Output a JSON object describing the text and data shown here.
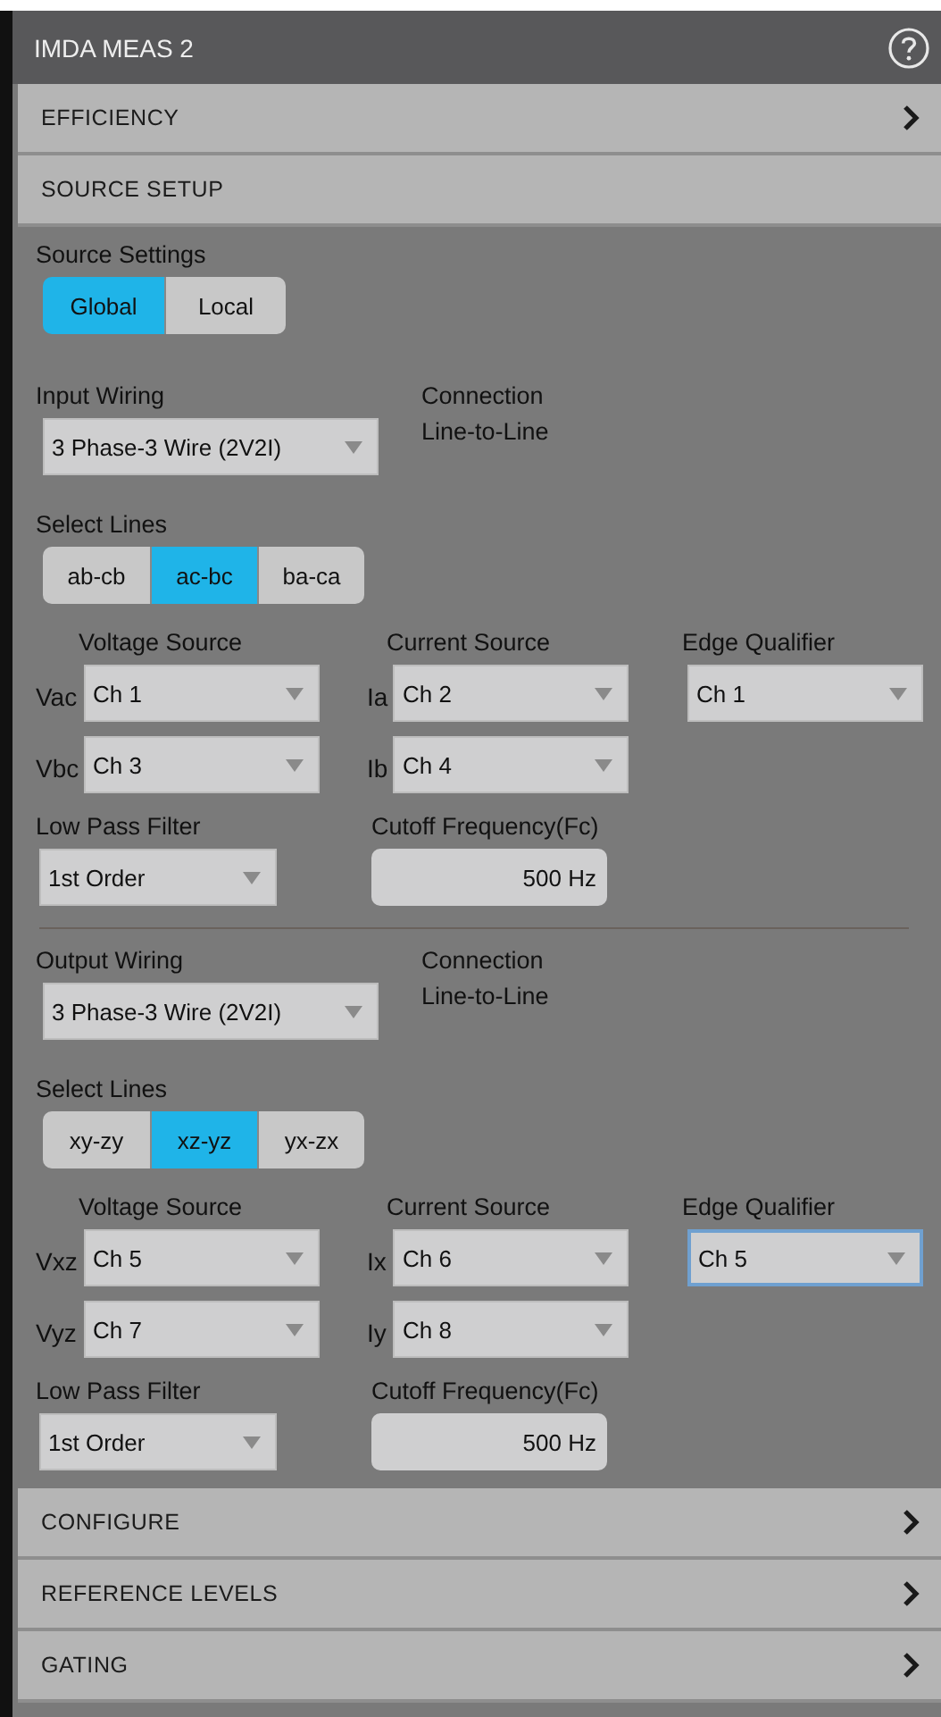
{
  "panel": {
    "title": "IMDA MEAS 2"
  },
  "sections_top": [
    {
      "label": "EFFICIENCY",
      "expanded": false
    }
  ],
  "source_setup": {
    "label": "SOURCE SETUP",
    "expanded": true,
    "source_settings": {
      "label": "Source Settings",
      "options": [
        {
          "label": "Global",
          "selected": true
        },
        {
          "label": "Local",
          "selected": false
        }
      ]
    },
    "groups": [
      {
        "wiring_label": "Input Wiring",
        "wiring_value": "3 Phase-3 Wire (2V2I)",
        "connection_label": "Connection",
        "connection_value": "Line-to-Line",
        "select_lines_label": "Select Lines",
        "lines": [
          {
            "label": "ab-cb",
            "selected": false
          },
          {
            "label": "ac-bc",
            "selected": true
          },
          {
            "label": "ba-ca",
            "selected": false
          }
        ],
        "voltage_heading": "Voltage Source",
        "current_heading": "Current Source",
        "edge_heading": "Edge Qualifier",
        "voltage_rows": [
          {
            "prefix": "Vac",
            "value": "Ch 1"
          },
          {
            "prefix": "Vbc",
            "value": "Ch 3"
          }
        ],
        "current_rows": [
          {
            "prefix": "Ia",
            "value": "Ch 2"
          },
          {
            "prefix": "Ib",
            "value": "Ch 4"
          }
        ],
        "edge_value": "Ch 1",
        "edge_focused": false,
        "filter_label": "Low Pass Filter",
        "filter_value": "1st Order",
        "cutoff_label": "Cutoff Frequency(Fc)",
        "cutoff_value": "500 Hz"
      },
      {
        "wiring_label": "Output Wiring",
        "wiring_value": "3 Phase-3 Wire (2V2I)",
        "connection_label": "Connection",
        "connection_value": "Line-to-Line",
        "select_lines_label": "Select Lines",
        "lines": [
          {
            "label": "xy-zy",
            "selected": false
          },
          {
            "label": "xz-yz",
            "selected": true
          },
          {
            "label": "yx-zx",
            "selected": false
          }
        ],
        "voltage_heading": "Voltage Source",
        "current_heading": "Current Source",
        "edge_heading": "Edge Qualifier",
        "voltage_rows": [
          {
            "prefix": "Vxz",
            "value": "Ch 5"
          },
          {
            "prefix": "Vyz",
            "value": "Ch 7"
          }
        ],
        "current_rows": [
          {
            "prefix": "Ix",
            "value": "Ch 6"
          },
          {
            "prefix": "Iy",
            "value": "Ch 8"
          }
        ],
        "edge_value": "Ch 5",
        "edge_focused": true,
        "filter_label": "Low Pass Filter",
        "filter_value": "1st Order",
        "cutoff_label": "Cutoff Frequency(Fc)",
        "cutoff_value": "500 Hz"
      }
    ]
  },
  "sections_bottom": [
    {
      "label": "CONFIGURE",
      "expanded": false
    },
    {
      "label": "REFERENCE LEVELS",
      "expanded": false
    },
    {
      "label": "GATING",
      "expanded": false
    }
  ]
}
